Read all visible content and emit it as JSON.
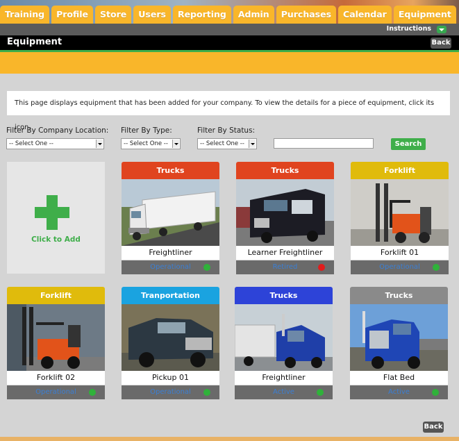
{
  "nav": {
    "tabs": [
      "Training",
      "Profile",
      "Store",
      "Users",
      "Reporting",
      "Admin",
      "Purchases",
      "Calendar",
      "Equipment"
    ]
  },
  "instructions_label": "Instructions",
  "page": {
    "title": "Equipment",
    "back_label": "Back",
    "info_text": "This page displays equipment that has been added for your company. To view the details for a piece of equipment, click its icon."
  },
  "filters": {
    "location_label": "Filter By Company Location:",
    "type_label": "Filter By Type:",
    "status_label": "Filter By Status:",
    "select_placeholder": "-- Select One --",
    "search_value": "",
    "search_label": "Search"
  },
  "add_card": {
    "label": "Click to Add"
  },
  "colors": {
    "trucks_red": "#e0441f",
    "forklift_yellow": "#e0bb0c",
    "transport_blue": "#1aa3e0",
    "trucks_blue": "#2d43d8",
    "trucks_gray": "#8a8a8a",
    "green_dot": "#2fb23a",
    "red_dot": "#e01c1c"
  },
  "equipment": [
    {
      "type": "Trucks",
      "name": "Freightliner",
      "status": "Operational",
      "status_color": "green",
      "header_color": "red"
    },
    {
      "type": "Trucks",
      "name": "Learner Freightliner",
      "status": "Retired",
      "status_color": "red",
      "header_color": "red"
    },
    {
      "type": "Forklift",
      "name": "Forklift 01",
      "status": "Operational",
      "status_color": "green",
      "header_color": "yellow"
    },
    {
      "type": "Forklift",
      "name": "Forklift 02",
      "status": "Operational",
      "status_color": "green",
      "header_color": "yellow"
    },
    {
      "type": "Tranportation",
      "name": "Pickup 01",
      "status": "Operational",
      "status_color": "green",
      "header_color": "lightblue"
    },
    {
      "type": "Trucks",
      "name": "Freightliner",
      "status": "Active",
      "status_color": "green",
      "header_color": "blue"
    },
    {
      "type": "Trucks",
      "name": "Flat Bed",
      "status": "Active",
      "status_color": "green",
      "header_color": "gray"
    }
  ]
}
